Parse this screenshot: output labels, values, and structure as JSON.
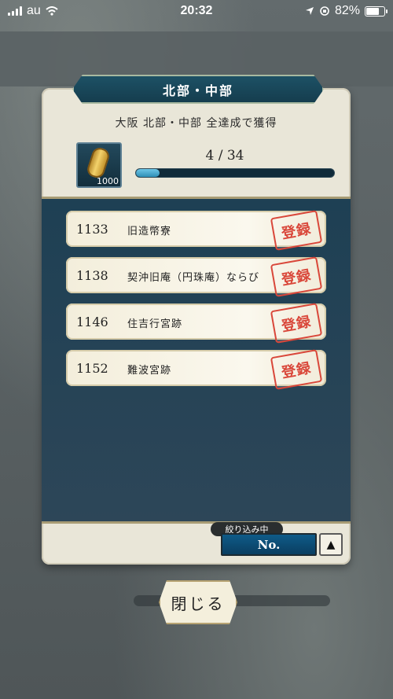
{
  "status_bar": {
    "carrier": "au",
    "time": "20:32",
    "battery_percent": "82%",
    "battery_level": 0.82
  },
  "dialog": {
    "title": "北部・中部",
    "subtitle": "大阪 北部・中部 全達成で獲得",
    "reward": {
      "icon": "gold-coin-icon",
      "quantity": "1000"
    },
    "progress": {
      "text": "4 / 34",
      "current": 4,
      "total": 34
    },
    "entries": [
      {
        "number": "1133",
        "name": "旧造幣寮",
        "stamp": "登録"
      },
      {
        "number": "1138",
        "name": "契沖旧庵（円珠庵）ならび",
        "stamp": "登録"
      },
      {
        "number": "1146",
        "name": "住吉行宮跡",
        "stamp": "登録"
      },
      {
        "number": "1152",
        "name": "難波宮跡",
        "stamp": "登録"
      }
    ],
    "filter": {
      "label": "絞り込み中",
      "sort_value": "No.",
      "sort_arrow": "▲"
    },
    "close_label": "閉じる"
  },
  "colors": {
    "accent": "#0f5b88",
    "stamp": "#d9473a",
    "panel": "#1e4054"
  }
}
